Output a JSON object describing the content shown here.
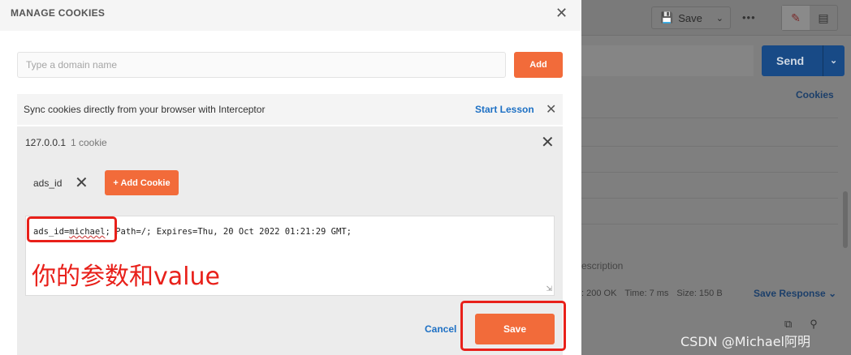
{
  "modal": {
    "title": "MANAGE COOKIES",
    "close_icon": "close-icon",
    "domain_input": {
      "placeholder": "Type a domain name",
      "value": ""
    },
    "add_label": "Add",
    "interceptor": {
      "text": "Sync cookies directly from your browser with Interceptor",
      "start_lesson": "Start Lesson"
    },
    "domain": {
      "name": "127.0.0.1",
      "count": "1 cookie",
      "cookies": [
        {
          "name": "ads_id"
        }
      ],
      "add_cookie_label": "+ Add Cookie",
      "editor": {
        "prefix": "ads_id=",
        "underlined": "michael",
        "suffix": "; Path=/; Expires=Thu, 20 Oct 2022 01:21:29 GMT;"
      }
    },
    "annotation": "你的参数和value",
    "cancel_label": "Cancel",
    "save_label": "Save",
    "accent_color": "#f26b3a",
    "link_color": "#1d70c4",
    "annotation_color": "#e8201a"
  },
  "background_app": {
    "save_label": "Save",
    "more_label": "•••",
    "send_label": "Send",
    "cookies_link": "Cookies",
    "description_fragment": "escription",
    "status": ": 200 OK",
    "time": "Time: 7 ms",
    "size": "Size: 150 B",
    "save_response": "Save Response",
    "send_color": "#184a86"
  },
  "watermark": "CSDN @Michael阿明"
}
